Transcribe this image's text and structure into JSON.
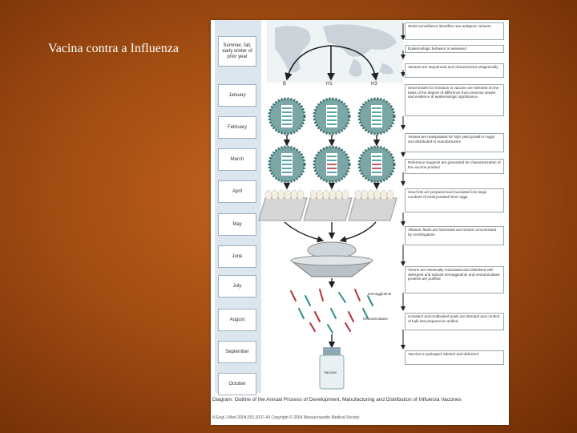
{
  "slide": {
    "title": "Vacina contra a Influenza"
  },
  "diagram": {
    "timeline": [
      "Summer, fall, early winter of prior year",
      "January",
      "February",
      "March",
      "April",
      "May",
      "June",
      "July",
      "August",
      "September",
      "October"
    ],
    "strains": [
      "B",
      "H1",
      "H3"
    ],
    "steps": [
      "World surveillance identifies new antigenic variants",
      "Epidemiologic behavior is assessed",
      "Variants are sequenced and characterized antigenically",
      "Seed strains for inclusion in vaccine are selected on the basis of the degree of difference from previous strains and evidence of epidemiologic significance",
      "Viruses are manipulated for high yield growth in eggs and distributed to manufacturers",
      "Reference reagents are generated for characterization of the vaccine product",
      "Seed lots are prepared and inoculated into large numbers of embryonated hens' eggs",
      "Allantoic fluids are harvested and virions concentrated by centrifugation",
      "Virions are chemically inactivated and dissolved with detergent and subunit hemagglutinin and neuraminidase proteins are purified",
      "Univalent and multivalent pools are blended and content of bulk lots prepared is verified",
      "Vaccine is packaged, labeled and delivered"
    ],
    "labels": {
      "ha": "Hemagglutinin",
      "na": "Neuraminidase",
      "vial": "Vaccine"
    },
    "caption": "Diagram: Outline of the Annual Process of Development, Manufacturing and Distribution of Influenza Vaccines",
    "credit": "N Engl J Med 2004;351:2037-40 Copyright © 2004 Massachusetts Medical Society"
  },
  "colors": {
    "background": "#a24d12",
    "accent": "#2f8f8f",
    "red": "#b8313b"
  }
}
